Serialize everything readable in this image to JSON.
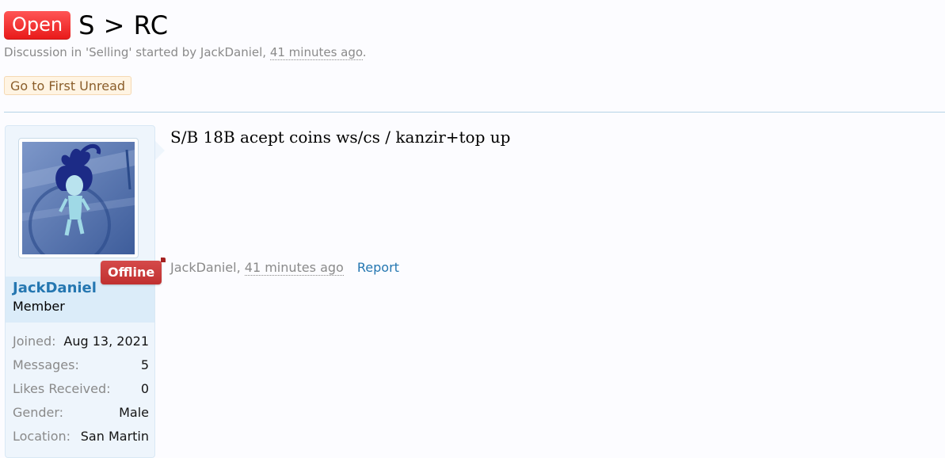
{
  "thread": {
    "prefix": "Open",
    "title": "S > RC",
    "description_prefix": "Discussion in 'Selling' started by ",
    "author": "JackDaniel",
    "separator": ", ",
    "time": "41 minutes ago",
    "period": ".",
    "go_to_first_unread": "Go to First Unread"
  },
  "user": {
    "name": "JackDaniel",
    "title": "Member",
    "status": "Offline",
    "avatar_icon": "anime-character-avatar",
    "stats": [
      {
        "label": "Joined:",
        "value": "Aug 13, 2021"
      },
      {
        "label": "Messages:",
        "value": "5"
      },
      {
        "label": "Likes Received:",
        "value": "0"
      },
      {
        "label": "Gender:",
        "value": "Male"
      },
      {
        "label": "Location:",
        "value": "San Martin"
      }
    ]
  },
  "post": {
    "body": "S/B 18B acept coins ws/cs / kanzir+top up",
    "author": "JackDaniel",
    "separator": ", ",
    "time": "41 minutes ago",
    "report_label": "Report"
  },
  "colors": {
    "prefix_open": "#e81919",
    "link": "#2577b1",
    "offline_badge": "#c03030",
    "panel_bg": "#eef5fc",
    "unread_bg": "#fff4e3"
  }
}
